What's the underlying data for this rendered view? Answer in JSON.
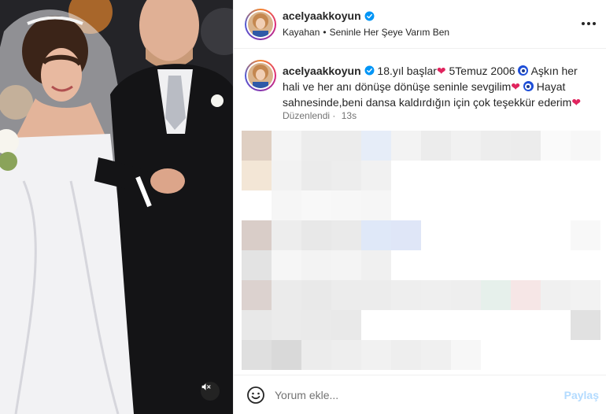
{
  "post": {
    "username": "acelyaakkoyun",
    "verified": true,
    "audio_artist": "Kayahan",
    "audio_separator": "•",
    "audio_title": "Seninle Her Şeye Varım Ben",
    "more_icon": "more-horizontal-icon"
  },
  "caption": {
    "username": "acelyaakkoyun",
    "part1": "18.yıl başlar",
    "part2": " 5Temuz 2006",
    "part3": " Aşkın her hali ve her anı dönüşe dönüşe seninle sevgilim",
    "part4": " Hayat sahnesinde,beni dansa kaldırdığın için çok teşekkür ederim",
    "edited_label": "Düzenlendi",
    "meta_separator": "·",
    "time": "13s"
  },
  "media": {
    "mute_icon": "speaker-muted-icon"
  },
  "comment_bar": {
    "emoji_icon": "emoji-smiley-icon",
    "placeholder": "Yorum ekle...",
    "share_label": "Paylaş"
  },
  "colors": {
    "link_disabled": "#b3dbff",
    "heart": "#e0245e",
    "verified": "#0095f6",
    "meta": "#737373"
  }
}
